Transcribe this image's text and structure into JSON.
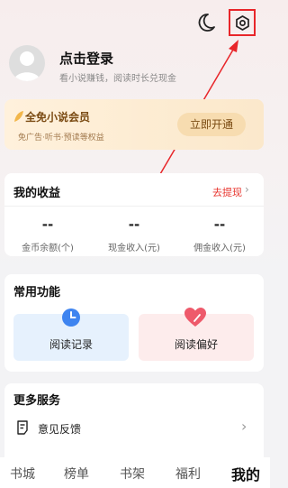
{
  "topbar": {
    "moon_icon": "moon-icon",
    "settings_icon": "settings-gear-icon",
    "highlight_color": "#e8262a"
  },
  "profile": {
    "title": "点击登录",
    "subtitle": "看小说赚钱，阅读时长兑现金"
  },
  "vip": {
    "title": "全免小说会员",
    "subtitle": "免广告·听书·预读等权益",
    "button": "立即开通"
  },
  "earnings": {
    "title": "我的收益",
    "withdraw": "去提现",
    "items": [
      {
        "value": "--",
        "label": "金币余额(个)"
      },
      {
        "value": "--",
        "label": "现金收入(元)"
      },
      {
        "value": "--",
        "label": "佣金收入(元)"
      }
    ]
  },
  "functions": {
    "title": "常用功能",
    "items": [
      {
        "label": "阅读记录",
        "icon": "clock-icon"
      },
      {
        "label": "阅读偏好",
        "icon": "heart-icon"
      }
    ]
  },
  "services": {
    "title": "更多服务",
    "items": [
      {
        "label": "意见反馈",
        "icon": "feedback-icon"
      }
    ]
  },
  "nav": {
    "items": [
      "书城",
      "榜单",
      "书架",
      "福利",
      "我的"
    ],
    "active_index": 4
  }
}
